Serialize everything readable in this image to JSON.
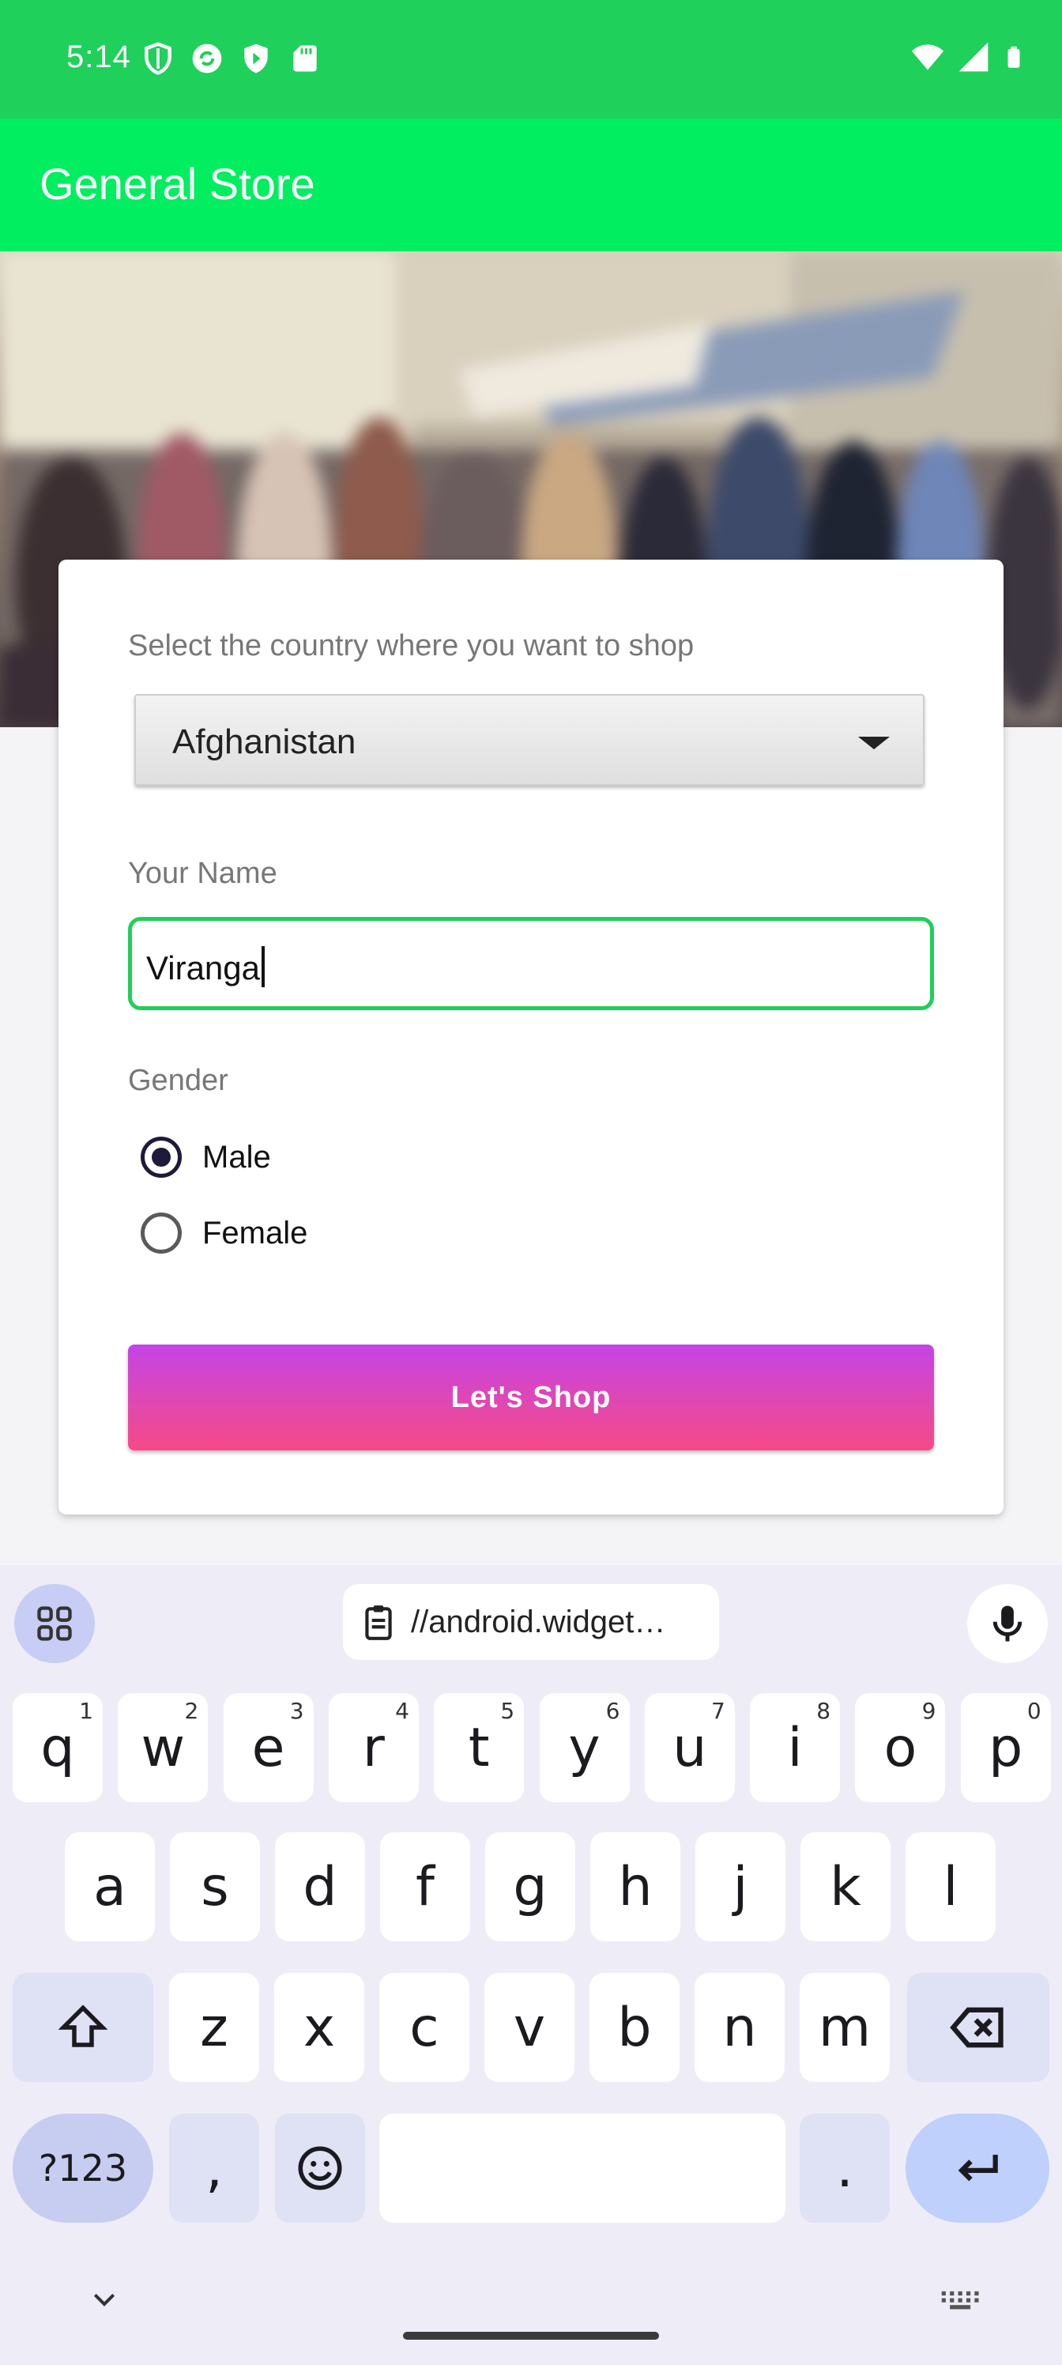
{
  "status_bar": {
    "time": "5:14",
    "left_icons": [
      "shield-icon",
      "sync-icon",
      "play-protect-icon",
      "sd-card-icon"
    ],
    "right_icons": [
      "wifi-icon",
      "signal-icon",
      "battery-icon"
    ]
  },
  "app_bar": {
    "title": "General Store"
  },
  "form": {
    "country_label": "Select the country where you want to shop",
    "country_value": "Afghanistan",
    "name_label": "Your Name",
    "name_value": "Viranga",
    "gender_label": "Gender",
    "gender_options": [
      {
        "label": "Male",
        "checked": true
      },
      {
        "label": "Female",
        "checked": false
      }
    ],
    "submit_label": "Let's  Shop"
  },
  "colors": {
    "status_bar": "#1fd05b",
    "app_bar": "#00ee60",
    "input_border": "#1fcf58",
    "button_top": "#c444e6",
    "button_bottom": "#f74a86"
  },
  "keyboard": {
    "clipboard_text": "//android.widget…",
    "row1": [
      {
        "k": "q",
        "h": "1"
      },
      {
        "k": "w",
        "h": "2"
      },
      {
        "k": "e",
        "h": "3"
      },
      {
        "k": "r",
        "h": "4"
      },
      {
        "k": "t",
        "h": "5"
      },
      {
        "k": "y",
        "h": "6"
      },
      {
        "k": "u",
        "h": "7"
      },
      {
        "k": "i",
        "h": "8"
      },
      {
        "k": "o",
        "h": "9"
      },
      {
        "k": "p",
        "h": "0"
      }
    ],
    "row2": [
      "a",
      "s",
      "d",
      "f",
      "g",
      "h",
      "j",
      "k",
      "l"
    ],
    "row3": [
      "z",
      "x",
      "c",
      "v",
      "b",
      "n",
      "m"
    ],
    "symbols_label": "?123",
    "comma_label": ",",
    "period_label": "."
  }
}
